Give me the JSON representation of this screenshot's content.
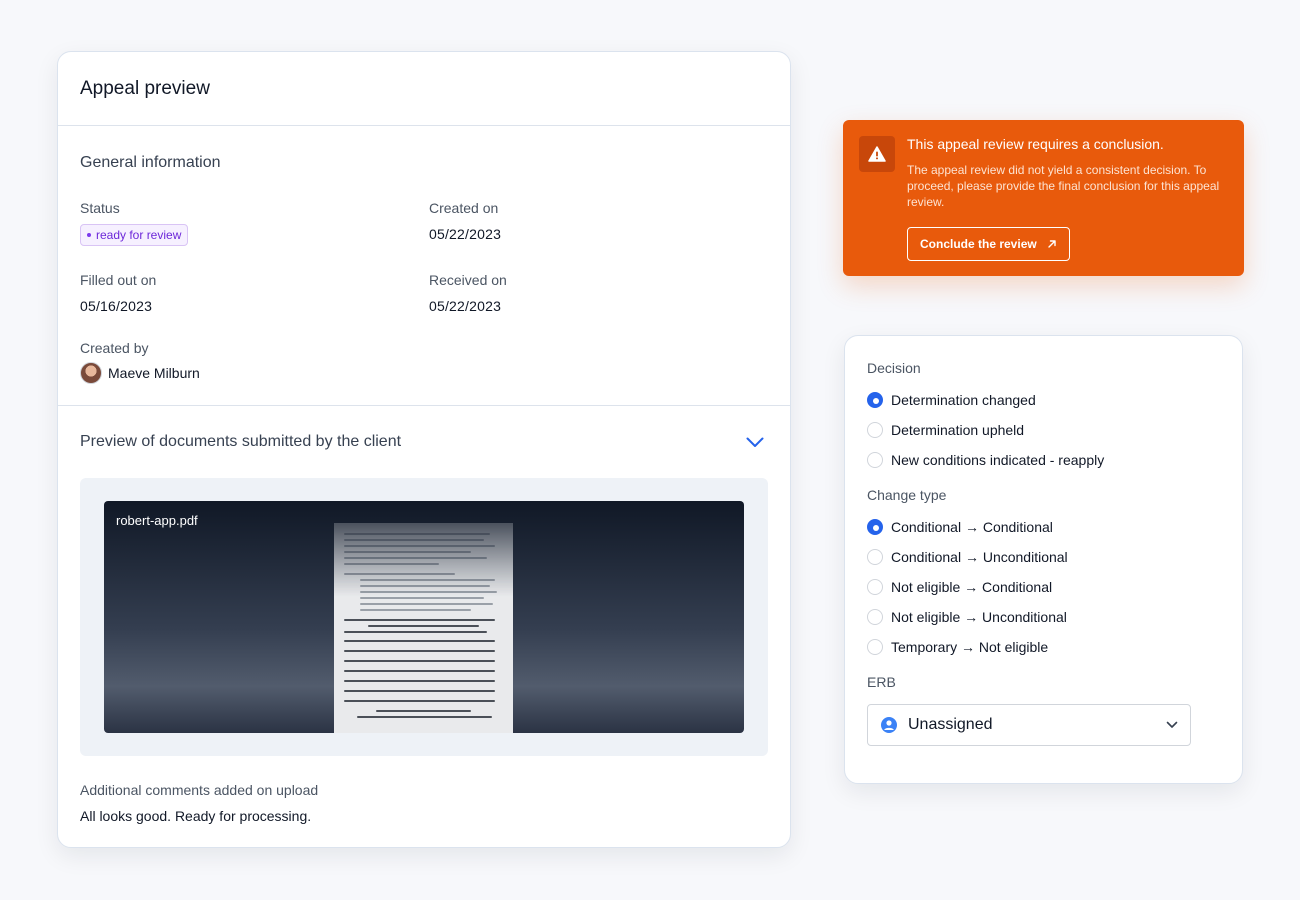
{
  "appeal": {
    "title": "Appeal preview",
    "general": {
      "heading": "General information",
      "status_label": "Status",
      "status_value": "ready for review",
      "created_on_label": "Created on",
      "created_on_value": "05/22/2023",
      "filled_label": "Filled out on",
      "filled_value": "05/16/2023",
      "received_label": "Received on",
      "received_value": "05/22/2023",
      "created_by_label": "Created by",
      "created_by_name": "Maeve Milburn"
    },
    "preview": {
      "heading": "Preview of documents submitted by the client",
      "file_name": "robert-app.pdf",
      "comments_label": "Additional comments added on upload",
      "comments_text": "All looks good. Ready for processing."
    }
  },
  "alert": {
    "title": "This appeal review requires a conclusion.",
    "text": "The appeal review did not yield a consistent decision. To proceed, please provide the final conclusion for this appeal review.",
    "button": "Conclude the review"
  },
  "decision": {
    "label": "Decision",
    "options": [
      {
        "label": "Determination changed",
        "checked": true
      },
      {
        "label": "Determination upheld",
        "checked": false
      },
      {
        "label": "New conditions indicated - reapply",
        "checked": false
      }
    ],
    "change_label": "Change type",
    "change_options": [
      {
        "label": "Conditional → Conditional",
        "checked": true
      },
      {
        "label": "Conditional → Unconditional",
        "checked": false
      },
      {
        "label": "Not eligible → Conditional",
        "checked": false
      },
      {
        "label": "Not eligible → Unconditional",
        "checked": false
      },
      {
        "label": "Temporary → Not eligible",
        "checked": false
      }
    ],
    "erb_label": "ERB",
    "erb_value": "Unassigned"
  },
  "colors": {
    "accent": "#2563eb",
    "alert": "#e85a0c",
    "badge": "#6d28d9"
  }
}
